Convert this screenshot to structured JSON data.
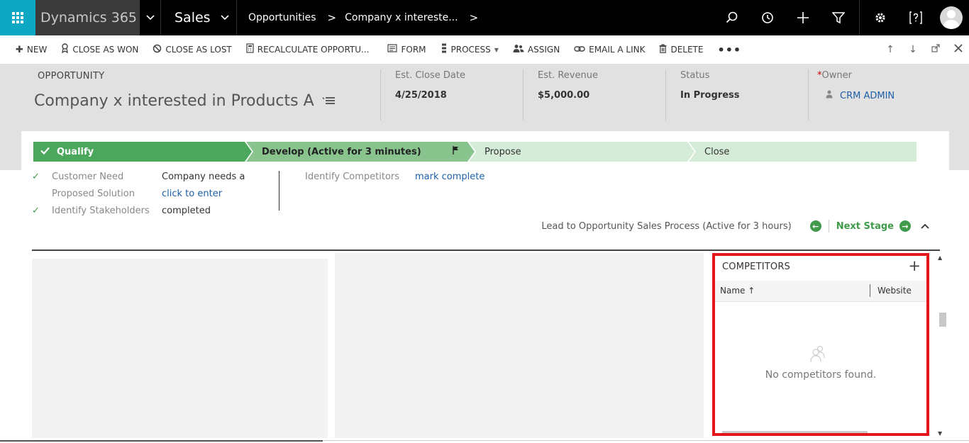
{
  "nav": {
    "brand": "Dynamics 365",
    "app": "Sales",
    "crumb1": "Opportunities",
    "crumb2": "Company x intereste...",
    "sep": ">"
  },
  "commands": {
    "new": "NEW",
    "close_won": "CLOSE AS WON",
    "close_lost": "CLOSE AS LOST",
    "recalc": "RECALCULATE OPPORTU...",
    "form": "FORM",
    "process": "PROCESS",
    "assign": "ASSIGN",
    "email_link": "EMAIL A LINK",
    "delete": "DELETE",
    "more": "•••"
  },
  "header": {
    "entity_type": "OPPORTUNITY",
    "record_name": "Company x interested in Products A",
    "fields": [
      {
        "label": "Est. Close Date",
        "value": "4/25/2018"
      },
      {
        "label": "Est. Revenue",
        "value": "$5,000.00"
      },
      {
        "label": "Status",
        "value": "In Progress"
      },
      {
        "label": "Owner",
        "value": "CRM ADMIN",
        "required": "*"
      }
    ]
  },
  "bpf": {
    "stages": [
      {
        "label": "Qualify"
      },
      {
        "label": "Develop (Active for 3 minutes)"
      },
      {
        "label": "Propose"
      },
      {
        "label": "Close"
      }
    ],
    "steps": [
      {
        "name": "Customer Need",
        "value": "Company needs a"
      },
      {
        "name": "Proposed Solution",
        "value": "click to enter"
      },
      {
        "name": "Identify Stakeholders",
        "value": "completed"
      }
    ],
    "steps2": [
      {
        "name": "Identify Competitors",
        "value": "mark complete"
      }
    ],
    "process_name": "Lead to Opportunity Sales Process (Active for 3 hours)",
    "next_stage": "Next Stage"
  },
  "competitors": {
    "title": "COMPETITORS",
    "col_name": "Name",
    "col_website": "Website",
    "empty": "No competitors found."
  }
}
